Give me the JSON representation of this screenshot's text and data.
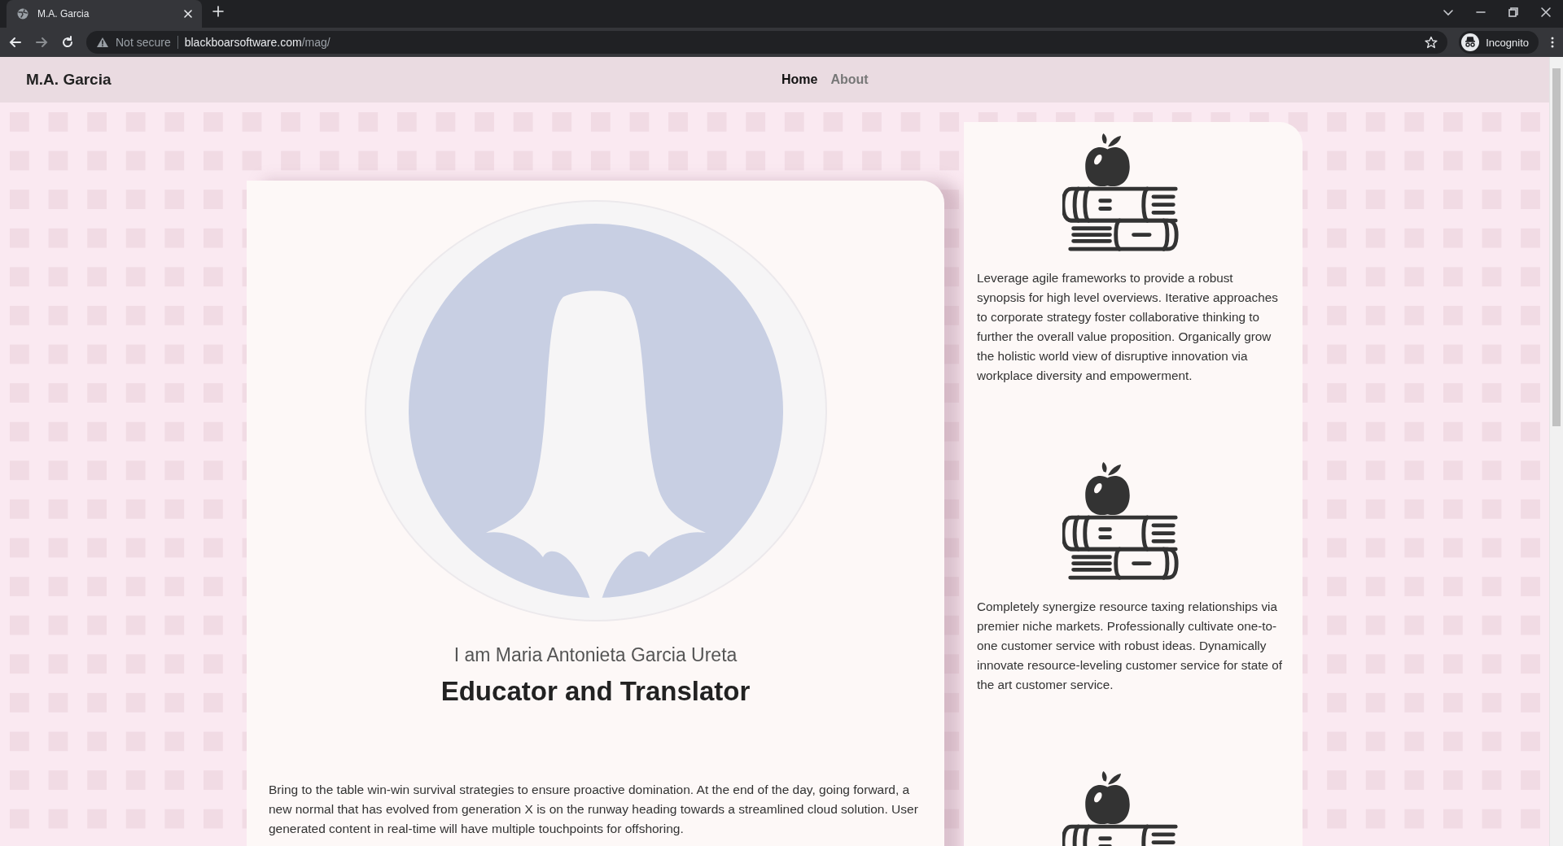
{
  "browser": {
    "tab_title": "M.A. Garcia",
    "security": "Not secure",
    "url_host": "blackboarsoftware.com",
    "url_path": "/mag/",
    "profile": "Incognito"
  },
  "nav": {
    "brand": "M.A. Garcia",
    "links": [
      {
        "label": "Home",
        "selected": true
      },
      {
        "label": "About",
        "selected": false
      }
    ]
  },
  "hero": {
    "intro": "I am Maria Antonieta Garcia Ureta",
    "title": "Educator and Translator",
    "paragraph": "Bring to the table win-win survival strategies to ensure proactive domination. At the end of the day, going forward, a new normal that has evolved from generation X is on the runway heading towards a streamlined cloud solution. User generated content in real-time will have multiple touchpoints for offshoring."
  },
  "features": [
    {
      "kind": "icon-text",
      "text": "Leverage agile frameworks to provide a robust synopsis for high level overviews. Iterative approaches to corporate strategy foster collaborative thinking to further the overall value proposition. Organically grow the holistic world view of disruptive innovation via workplace diversity and empowerment."
    },
    {
      "kind": "icon-text",
      "text": "Completely synergize resource taxing relationships via premier niche markets. Professionally cultivate one-to-one customer service with robust ideas. Dynamically innovate resource-leveling customer service for state of the art customer service."
    },
    {
      "kind": "icon"
    }
  ]
}
